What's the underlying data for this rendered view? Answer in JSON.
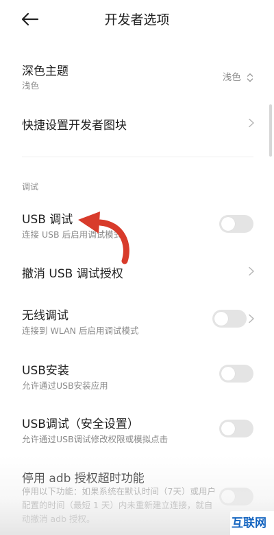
{
  "header": {
    "title": "开发者选项"
  },
  "rows": {
    "dark_theme": {
      "label": "深色主题",
      "sub": "浅色",
      "value": "浅色"
    },
    "quick_tiles": {
      "label": "快捷设置开发者图块"
    },
    "section_debug": "调试",
    "usb_debug": {
      "label": "USB 调试",
      "sub": "连接 USB 后启用调试模式",
      "enabled": false
    },
    "revoke_usb": {
      "label": "撤消 USB 调试授权"
    },
    "wireless_debug": {
      "label": "无线调试",
      "sub": "连接到 WLAN 后启用调试模式",
      "enabled": false
    },
    "usb_install": {
      "label": "USB安装",
      "sub": "允许通过USB安装应用",
      "enabled": false
    },
    "usb_debug_secure": {
      "label": "USB调试（安全设置）",
      "sub": "允许通过USB调试修改权限或模拟点击",
      "enabled": false
    },
    "adb_timeout": {
      "label": "停用 adb 授权超时功能",
      "sub": "停用以下功能：如果系统在默认时间（7天）或用户配置的时间（最短 1 天）内未重新建立连接，就自动撤消 adb 授权。",
      "enabled": false
    }
  },
  "watermark": {
    "text": "互联网",
    "color": "#1565c0"
  },
  "colors": {
    "toggle_off": "#e4e4e4",
    "annotation_arrow": "#d83b2b"
  }
}
